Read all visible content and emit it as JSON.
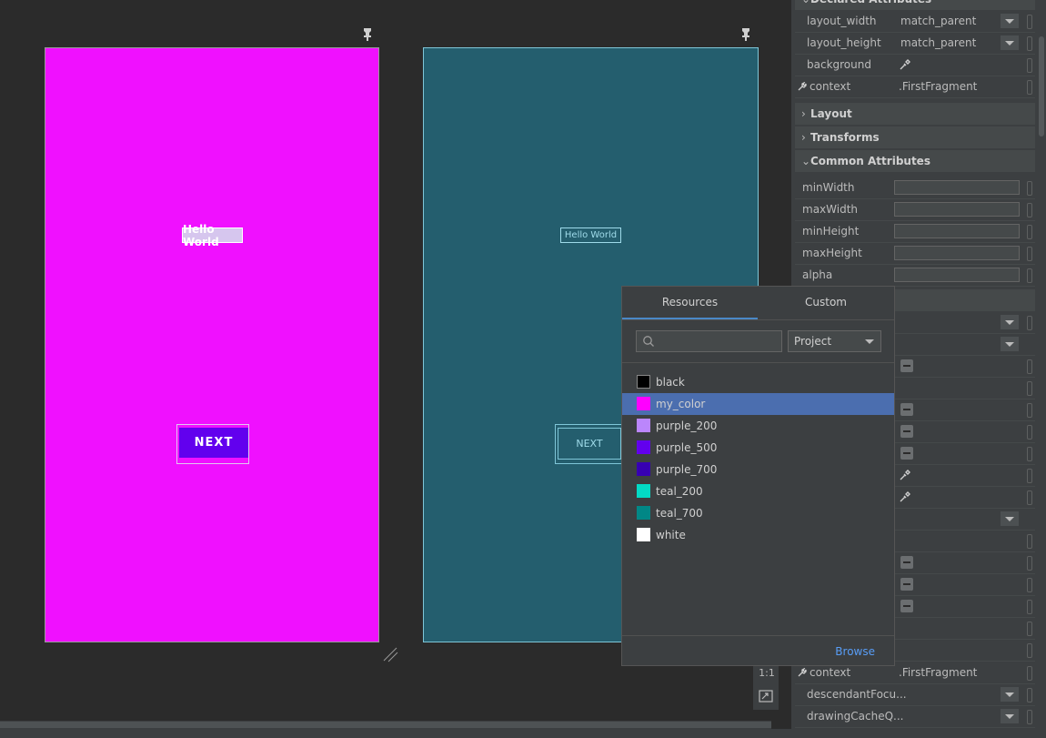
{
  "canvas": {
    "phone_left": {
      "background": "#f010ff",
      "hello": "Hello World",
      "next": "NEXT"
    },
    "phone_right": {
      "background": "#245e6e",
      "hello": "Hello World",
      "next": "NEXT"
    },
    "zoom_label": "1:1"
  },
  "panel": {
    "declared_header": "Declared Attributes",
    "declared": [
      {
        "name": "layout_width",
        "value": "match_parent"
      },
      {
        "name": "layout_height",
        "value": "match_parent"
      },
      {
        "name": "background",
        "value": ""
      },
      {
        "name": "context",
        "value": ".FirstFragment"
      }
    ],
    "sections": [
      "Layout",
      "Transforms",
      "Common Attributes"
    ],
    "common": [
      "minWidth",
      "maxWidth",
      "minHeight",
      "maxHeight",
      "alpha"
    ],
    "bottom": [
      {
        "name": "context",
        "value": ".FirstFragment"
      },
      {
        "name": "descendantFocu...",
        "value": ""
      },
      {
        "name": "drawingCacheQ...",
        "value": ""
      }
    ]
  },
  "popup": {
    "tabs": [
      "Resources",
      "Custom"
    ],
    "search_placeholder": "",
    "scope": "Project",
    "colors": [
      {
        "name": "black",
        "hex": "#000000"
      },
      {
        "name": "my_color",
        "hex": "#ff00ff"
      },
      {
        "name": "purple_200",
        "hex": "#bb86fc"
      },
      {
        "name": "purple_500",
        "hex": "#6200ee"
      },
      {
        "name": "purple_700",
        "hex": "#3700b3"
      },
      {
        "name": "teal_200",
        "hex": "#03dac5"
      },
      {
        "name": "teal_700",
        "hex": "#018786"
      },
      {
        "name": "white",
        "hex": "#ffffff"
      }
    ],
    "selected": "my_color",
    "browse": "Browse"
  }
}
